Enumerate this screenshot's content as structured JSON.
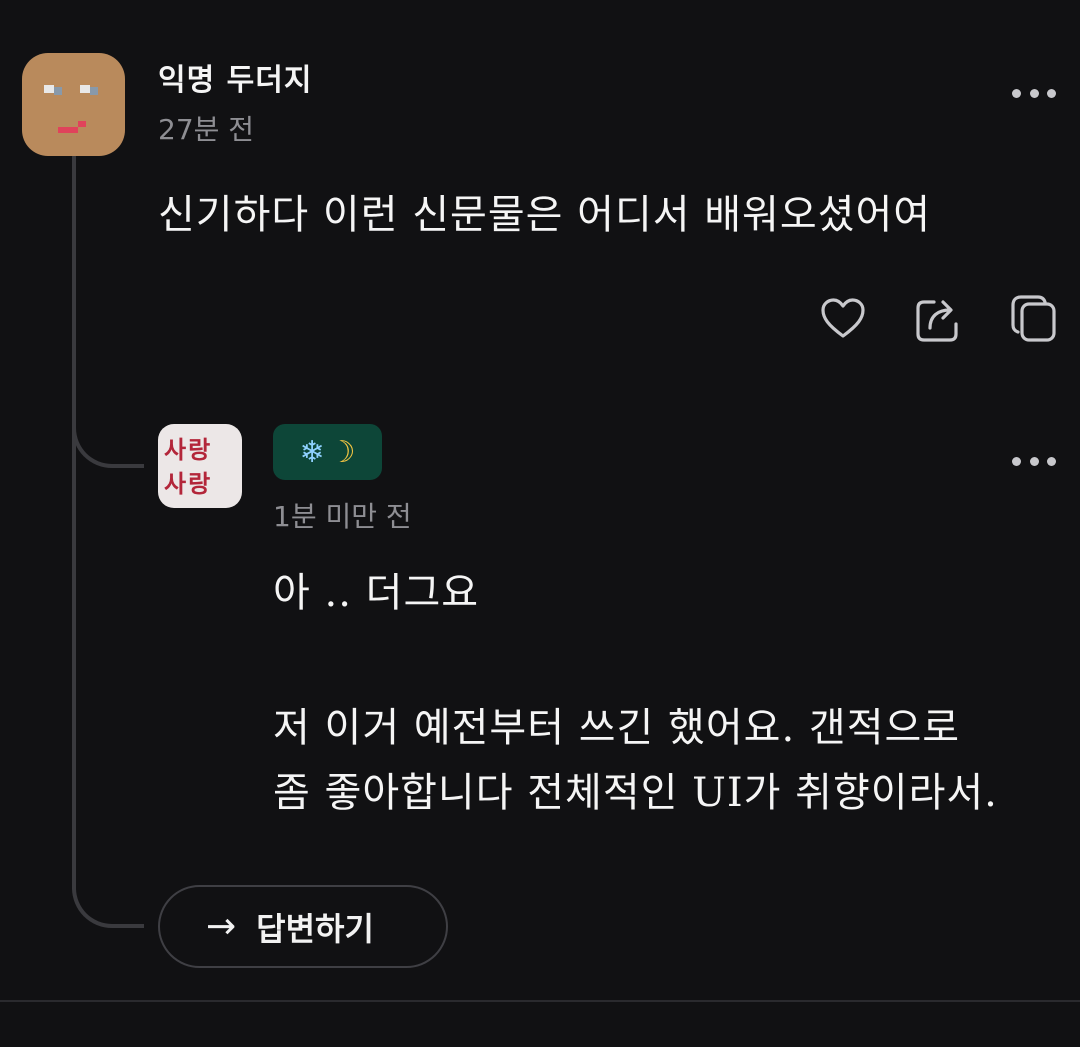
{
  "post": {
    "username": "익명 두더지",
    "time": "27분 전",
    "content": "신기하다 이런 신문물은 어디서 배워오셨어여",
    "avatar_icon": "pixel-face-avatar",
    "colors": {
      "avatar_bg": "#b98a5c"
    }
  },
  "actions": {
    "like_icon": "heart-icon",
    "share_icon": "share-icon",
    "copy_icon": "copy-icon"
  },
  "reply": {
    "badge": {
      "snow": "❄",
      "moon": "☽"
    },
    "time": "1분 미만 전",
    "avatar_label_line1": "사랑",
    "avatar_label_line2": "사랑",
    "lines": [
      "아 .. 더그요",
      "저 이거 예전부터 쓰긴 했어요. 갠적으로",
      "좀 좋아합니다 전체적인 UI가 취향이라서."
    ],
    "colors": {
      "badge_bg": "#0d4638"
    }
  },
  "reply_button": {
    "arrow": "→",
    "label": "답변하기"
  }
}
